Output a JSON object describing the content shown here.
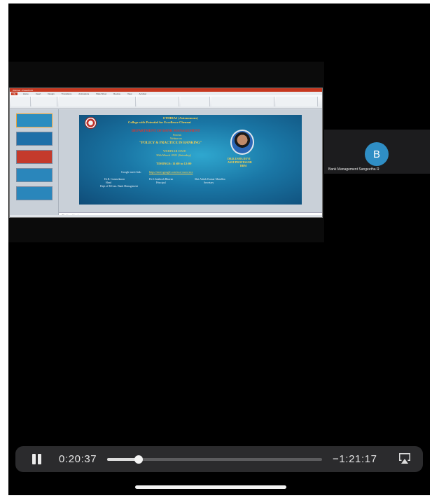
{
  "slide": {
    "college_line1": "ETHIRAJ (Autonomous)",
    "college_line2": "College with Potential for Excellence Chennai",
    "department": "DEPARTMENT OF BANK MANAGEMENT",
    "presents": "Presents",
    "webinar": "Webinar on",
    "topic": "\"POLICY & PRACTICE IN BANKING\"",
    "date_label": "WEBINAR DATE",
    "date": "30th March 2021 (Saturday)",
    "time": "TIMINGS: 11:00 to 12:00",
    "speaker1": "DR.R.USHA DEVI",
    "speaker2": "ASST.PROFESSOR",
    "speaker3": "BRM",
    "meet_label": "Google meet link:",
    "meet_link": "https://meet.google.com/xxx-xxxx-xxx",
    "sig1_name": "Dr.R. Gunasekaran",
    "sig1_role1": "Head",
    "sig1_role2": "Dept of B.Com. Bank Management",
    "sig2_name": "Dr.S.Santhosh Bhavan",
    "sig2_role": "Principal",
    "sig3_name": "Shri.Ashok Kumar Mundhra",
    "sig3_role": "Secretary"
  },
  "ppt": {
    "window_title": "Webinar - PowerPoint",
    "tabs": [
      "File",
      "Home",
      "Insert",
      "Design",
      "Transitions",
      "Animations",
      "Slide Show",
      "Review",
      "View",
      "Acrobat"
    ],
    "notes_placeholder": "Click to add notes"
  },
  "participant": {
    "initial": "B",
    "name": "Bank Management Sangeetha R",
    "avatar_color": "#2f8ec5"
  },
  "player": {
    "elapsed": "0:20:37",
    "remaining": "−1:21:17",
    "progress": 0.145,
    "state": "playing",
    "pause_icon": "pause-icon",
    "airplay_icon": "airplay-icon"
  }
}
